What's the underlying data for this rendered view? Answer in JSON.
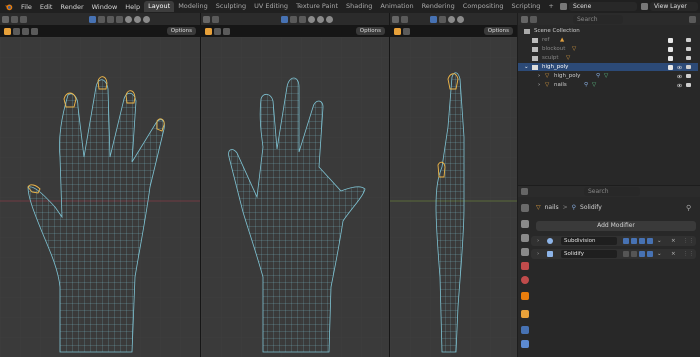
{
  "menu": {
    "items": [
      "File",
      "Edit",
      "Render",
      "Window",
      "Help"
    ]
  },
  "workspaces": {
    "tabs": [
      "Layout",
      "Modeling",
      "Sculpting",
      "UV Editing",
      "Texture Paint",
      "Shading",
      "Animation",
      "Rendering",
      "Compositing",
      "Scripting"
    ],
    "add_label": "+",
    "active": "Layout"
  },
  "scene": {
    "label": "Scene"
  },
  "view_layer": {
    "label": "View Layer"
  },
  "viewports": {
    "options_label": "Options"
  },
  "outliner": {
    "search_placeholder": "Search",
    "scene_collection_label": "Scene Collection",
    "items": [
      {
        "label": "ref"
      },
      {
        "label": "blockout"
      },
      {
        "label": "sculpt"
      },
      {
        "label": "high_poly"
      },
      {
        "label": "high_poly"
      },
      {
        "label": "nails"
      }
    ]
  },
  "properties": {
    "search_placeholder": "Search",
    "breadcrumb_object": "nails",
    "breadcrumb_sep": ">",
    "breadcrumb_modifier": "Solidify",
    "add_modifier_label": "Add Modifier",
    "modifiers": [
      {
        "name": "Subdivision"
      },
      {
        "name": "Solidify"
      }
    ]
  },
  "colors": {
    "accent": "#4772b3",
    "selected_row": "#2c4a77",
    "wire": "#7fc4d4",
    "selected_wire": "#f0b84a",
    "grid_bg": "#3a3a3a",
    "x_axis": "#a53c4a",
    "y_axis": "#7a9a3a"
  }
}
